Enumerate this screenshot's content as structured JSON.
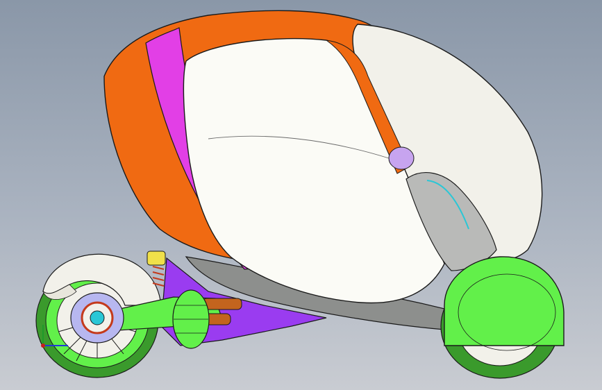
{
  "viewport": {
    "background_top": "#8a97a8",
    "background_bottom": "#c9ccd2"
  },
  "model": {
    "colors": {
      "shell_orange": "#f06a12",
      "shell_orange_dark": "#c94c08",
      "magenta_band": "#e23fe6",
      "window_white": "#fbfbf6",
      "grey_body": "#8d8f8d",
      "purple_frame": "#9a3cf0",
      "green_parts": "#62f04a",
      "green_dark": "#3a9a2c",
      "wheel_white": "#f2f1ea",
      "hub_blue": "#b7b7f0",
      "spring_red": "#c43a1c",
      "copper": "#c3641e",
      "yellow_part": "#f0e04a",
      "teal_line": "#29c7d6",
      "edge_line": "#1a1a1a"
    }
  },
  "triad": {
    "x_color": "#1f3ad6",
    "y_color": "#c61e1e",
    "z_color": "#1e9a2a"
  }
}
